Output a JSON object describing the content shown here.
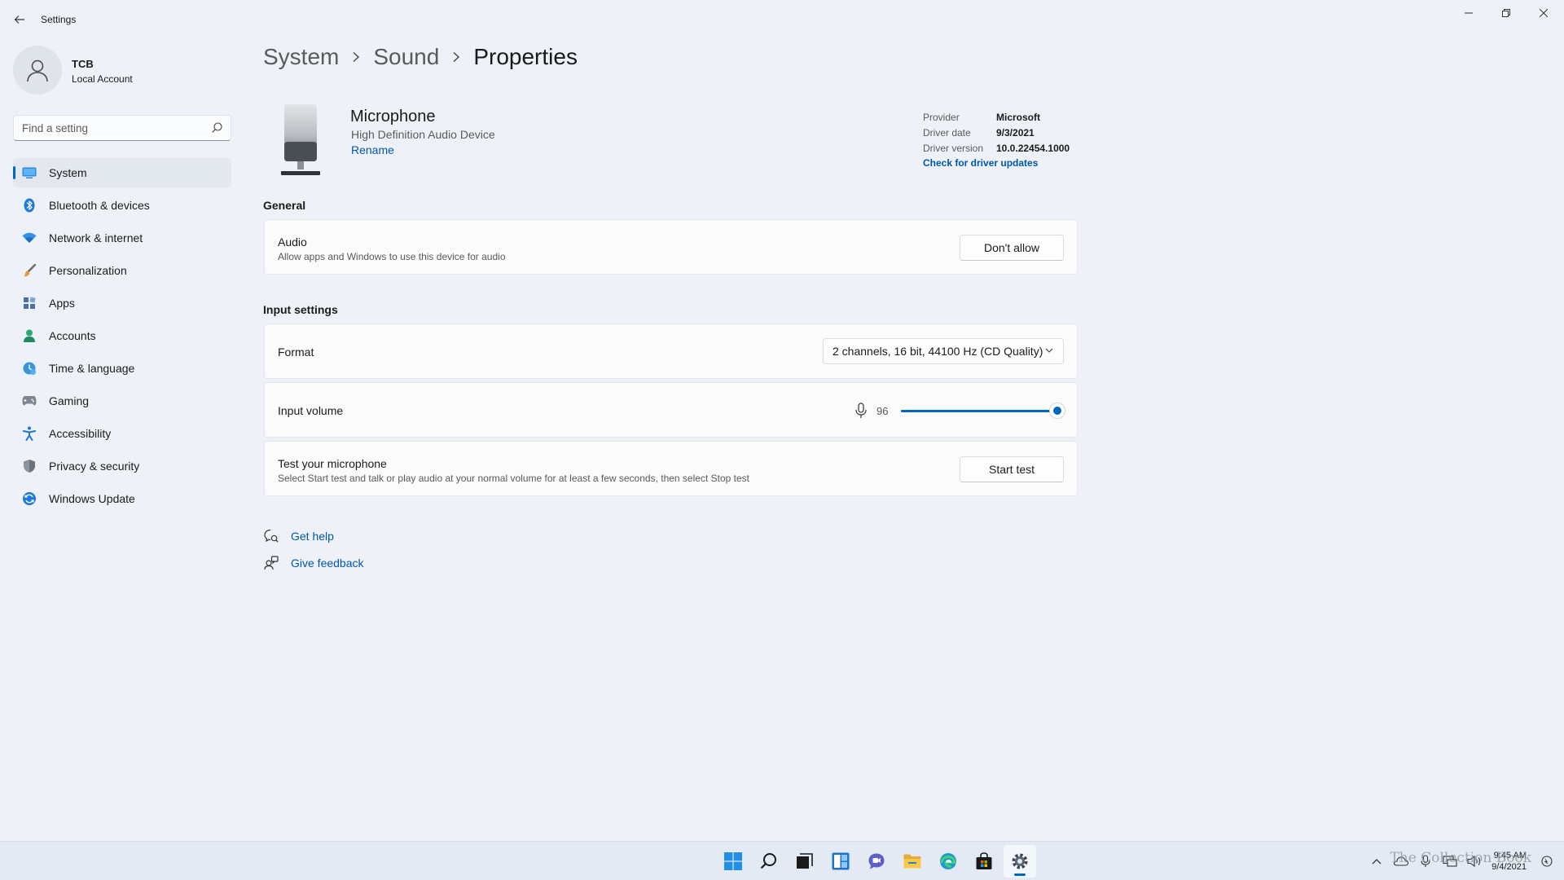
{
  "window": {
    "title": "Settings",
    "controls": {
      "minimize": "minimize",
      "maximize": "restore",
      "close": "close"
    }
  },
  "profile": {
    "name": "TCB",
    "account_type": "Local Account"
  },
  "search": {
    "placeholder": "Find a setting",
    "value": ""
  },
  "sidebar": {
    "items": [
      {
        "label": "System",
        "icon": "system-icon",
        "active": true
      },
      {
        "label": "Bluetooth & devices",
        "icon": "bluetooth-icon"
      },
      {
        "label": "Network & internet",
        "icon": "wifi-icon"
      },
      {
        "label": "Personalization",
        "icon": "brush-icon"
      },
      {
        "label": "Apps",
        "icon": "apps-icon"
      },
      {
        "label": "Accounts",
        "icon": "accounts-icon"
      },
      {
        "label": "Time & language",
        "icon": "time-language-icon"
      },
      {
        "label": "Gaming",
        "icon": "gaming-icon"
      },
      {
        "label": "Accessibility",
        "icon": "accessibility-icon"
      },
      {
        "label": "Privacy & security",
        "icon": "shield-icon"
      },
      {
        "label": "Windows Update",
        "icon": "update-icon"
      }
    ]
  },
  "breadcrumb": {
    "items": [
      "System",
      "Sound",
      "Properties"
    ]
  },
  "device": {
    "name": "Microphone",
    "description": "High Definition Audio Device",
    "rename_label": "Rename"
  },
  "driver": {
    "provider_label": "Provider",
    "provider": "Microsoft",
    "date_label": "Driver date",
    "date": "9/3/2021",
    "version_label": "Driver version",
    "version": "10.0.22454.1000",
    "update_link": "Check for driver updates"
  },
  "general": {
    "title": "General",
    "audio": {
      "title": "Audio",
      "description": "Allow apps and Windows to use this device for audio",
      "button": "Don't allow"
    }
  },
  "input_settings": {
    "title": "Input settings",
    "format": {
      "label": "Format",
      "value": "2 channels, 16 bit, 44100 Hz (CD Quality)"
    },
    "volume": {
      "label": "Input volume",
      "value": "96",
      "level": 96
    },
    "test": {
      "title": "Test your microphone",
      "description": "Select Start test and talk or play audio at your normal volume for at least a few seconds, then select Stop test",
      "button": "Start test"
    }
  },
  "help": {
    "get_help": "Get help",
    "give_feedback": "Give feedback"
  },
  "taskbar": {
    "apps": [
      "start-icon",
      "search-icon",
      "task-view-icon",
      "widgets-icon",
      "chat-icon",
      "file-explorer-icon",
      "edge-icon",
      "store-icon",
      "settings-icon"
    ],
    "active_app": "settings-icon",
    "time": "9:45 AM",
    "date": "9/4/2021",
    "watermark": "The Collection Book"
  },
  "colors": {
    "accent": "#0067c0",
    "link": "#0057a8",
    "background": "#eef2f8",
    "card": "#fbfbfc"
  }
}
